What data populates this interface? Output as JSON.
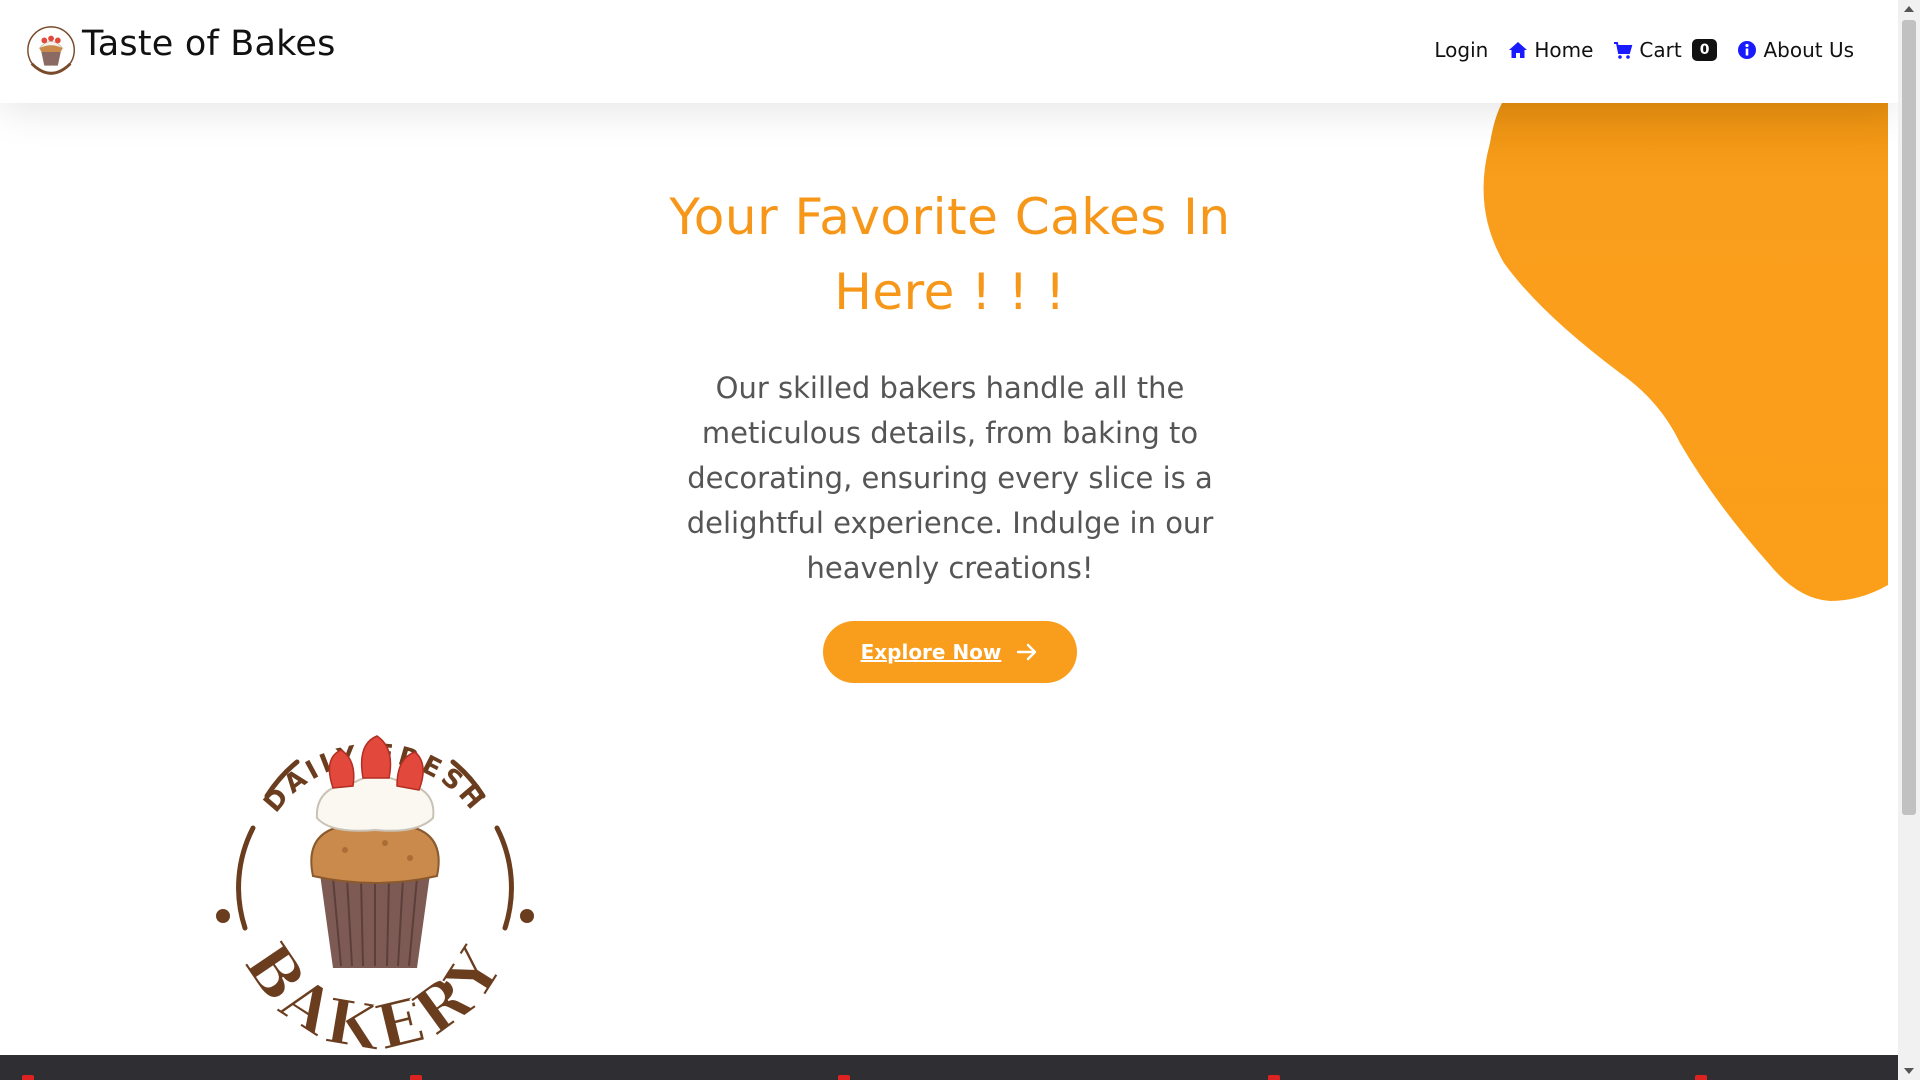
{
  "brand": {
    "name": "Taste of Bakes",
    "logo_icon": "bakery-cupcake-logo-icon"
  },
  "nav": {
    "login": "Login",
    "home": "Home",
    "cart": "Cart",
    "cart_count": "0",
    "about": "About Us"
  },
  "hero": {
    "title": "Your Favorite Cakes In Here ! ! !",
    "text": "Our skilled bakers handle all the meticulous details, from baking to decorating, ensuring every slice is a delightful experience. Indulge in our heavenly creations!",
    "button": "Explore Now"
  },
  "badge": {
    "top_text": "DAILY FRESH",
    "bottom_text": "BAKERY"
  },
  "colors": {
    "accent": "#f99d1c",
    "title": "#f6971a",
    "nav_icon": "#1a1aff",
    "footer": "#2e2e33"
  }
}
